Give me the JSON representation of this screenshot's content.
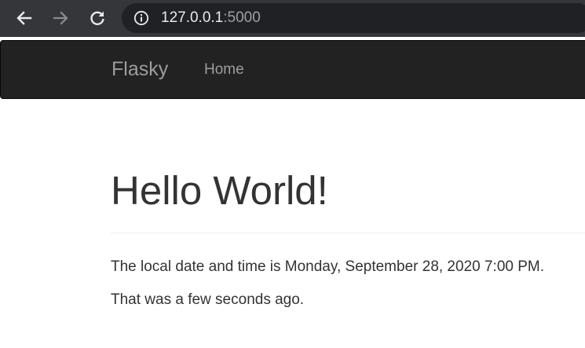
{
  "browser": {
    "url_host": "127.0.0.1",
    "url_port": ":5000",
    "icons": {
      "back": "arrow-left-icon",
      "forward": "arrow-right-icon",
      "reload": "reload-icon",
      "info": "info-icon"
    }
  },
  "navbar": {
    "brand": "Flasky",
    "items": [
      {
        "label": "Home"
      }
    ]
  },
  "main": {
    "heading": "Hello World!",
    "datetime_text": "The local date and time is Monday, September 28, 2020 7:00 PM.",
    "relative_text": "That was a few seconds ago."
  },
  "colors": {
    "chrome": "#35363a",
    "omnibox": "#202124",
    "navbar": "#222222",
    "navbar_text": "#9d9d9d",
    "body_text": "#333333"
  }
}
